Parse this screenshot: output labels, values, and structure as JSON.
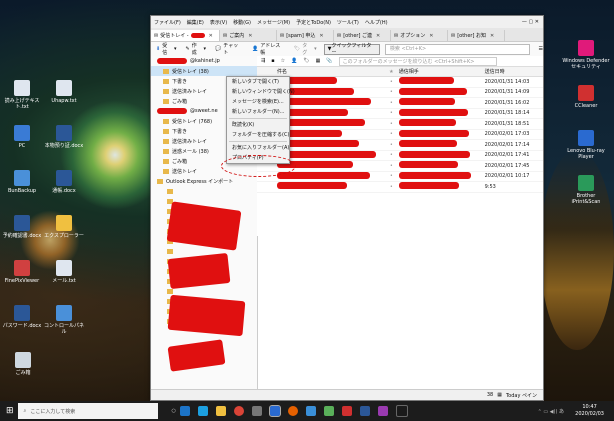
{
  "desktop_left": [
    {
      "label": "読み上げテキスト.txt",
      "color": "#dfe6ef"
    },
    {
      "label": "PC",
      "color": "#3a7bd5"
    },
    {
      "label": "BunBackup",
      "color": "#4a90d9"
    },
    {
      "label": "予約確認書.docx",
      "color": "#2b5797"
    },
    {
      "label": "FinePixViewer",
      "color": "#d04040"
    },
    {
      "label": "パスワード.docx",
      "color": "#2b5797"
    }
  ],
  "desktop_left2": [
    {
      "label": "Uhapw.txt",
      "color": "#dfe6ef"
    },
    {
      "label": "本物預り証.docx",
      "color": "#2b5797"
    },
    {
      "label": "通帳.docx",
      "color": "#2b5797"
    },
    {
      "label": "エクスプローラー",
      "color": "#f0c040"
    },
    {
      "label": "メール.txt",
      "color": "#dfe6ef"
    },
    {
      "label": "コントロールパネル",
      "color": "#4a90d9"
    }
  ],
  "desktop_right": [
    {
      "label": "Windows Defender セキュリティ",
      "color": "#e01a7a"
    },
    {
      "label": "CCleaner",
      "color": "#d03030"
    },
    {
      "label": "Lenovo Blu-ray Player",
      "color": "#2a6ad0"
    },
    {
      "label": "Brother iPrint&Scan",
      "color": "#2a9a5a"
    }
  ],
  "recycle_bin": "ごみ箱",
  "menubar": [
    "ファイル(F)",
    "編集(E)",
    "表示(V)",
    "移動(G)",
    "メッセージ(M)",
    "予定とToDo(N)",
    "ツール(T)",
    "ヘルプ(H)"
  ],
  "tabs": [
    {
      "label": "受信トレイ - "
    },
    {
      "label": "ご案内"
    },
    {
      "label": "[spam] 申込"
    },
    {
      "label": "[other] ご連"
    },
    {
      "label": "オプション"
    },
    {
      "label": "[other] お知"
    }
  ],
  "toolbar": {
    "get_label": "受信",
    "compose_label": "作成",
    "chat_label": "チャット",
    "address_label": "アドレス帳",
    "tag_label": "タグ",
    "quickfilter_label": "クイックフィルター",
    "search_placeholder": "検索 <Ctrl+K>"
  },
  "folders": [
    {
      "label": "受信トレイ (38)",
      "selected": true
    },
    {
      "label": "下書き"
    },
    {
      "label": "送信済みトレイ"
    },
    {
      "label": "ごみ箱"
    },
    {
      "label": "@sweet.ne"
    },
    {
      "label": "受信トレイ (768)"
    },
    {
      "label": "下書き"
    },
    {
      "label": "送信済みトレイ"
    },
    {
      "label": "迷惑メール (38)"
    },
    {
      "label": "ごみ箱"
    },
    {
      "label": "送信トレイ"
    },
    {
      "label": "Outlook Express インポート"
    }
  ],
  "account1_suffix": "@kahinet.jp",
  "context_menu": [
    "新しいタブで開く(T)",
    "新しいウィンドウで開く(N)",
    "メッセージを検索(E)...",
    "新しいフォルダー(N)...",
    "---",
    "既読化(K)",
    "フォルダーを圧縮する(C)",
    "---",
    "お気に入りフォルダー(A)",
    "プロパティ(P)"
  ],
  "list_toolbar_icons": [
    "thread-icon",
    "star-icon",
    "attach-icon",
    "contact-icon",
    "tag-icon",
    "calendar-icon",
    "filter-icon"
  ],
  "list_search_placeholder": "このフォルダーのメッセージを絞り込む <Ctrl+Shift+K>",
  "list_headers": {
    "subject": "件名",
    "correspondent": "通信相手",
    "date": "送信日時"
  },
  "messages": [
    {
      "date": "2020/01/31 14:03"
    },
    {
      "date": "2020/01/31 14:09"
    },
    {
      "date": "2020/01/31 16:02"
    },
    {
      "date": "2020/01/31 18:14"
    },
    {
      "date": "2020/01/31 18:51"
    },
    {
      "date": "2020/02/01 17:03"
    },
    {
      "date": "2020/02/01 17:14"
    },
    {
      "date": "2020/02/01 17:41"
    },
    {
      "date": "2020/02/01 17:45"
    },
    {
      "date": "2020/02/01 10:17"
    },
    {
      "date": "9:53"
    }
  ],
  "status": {
    "count": "38",
    "today_pane": "Today ペイン"
  },
  "taskbar": {
    "search_placeholder": "ここに入力して検索",
    "time": "10:47",
    "date": "2020/02/03"
  }
}
